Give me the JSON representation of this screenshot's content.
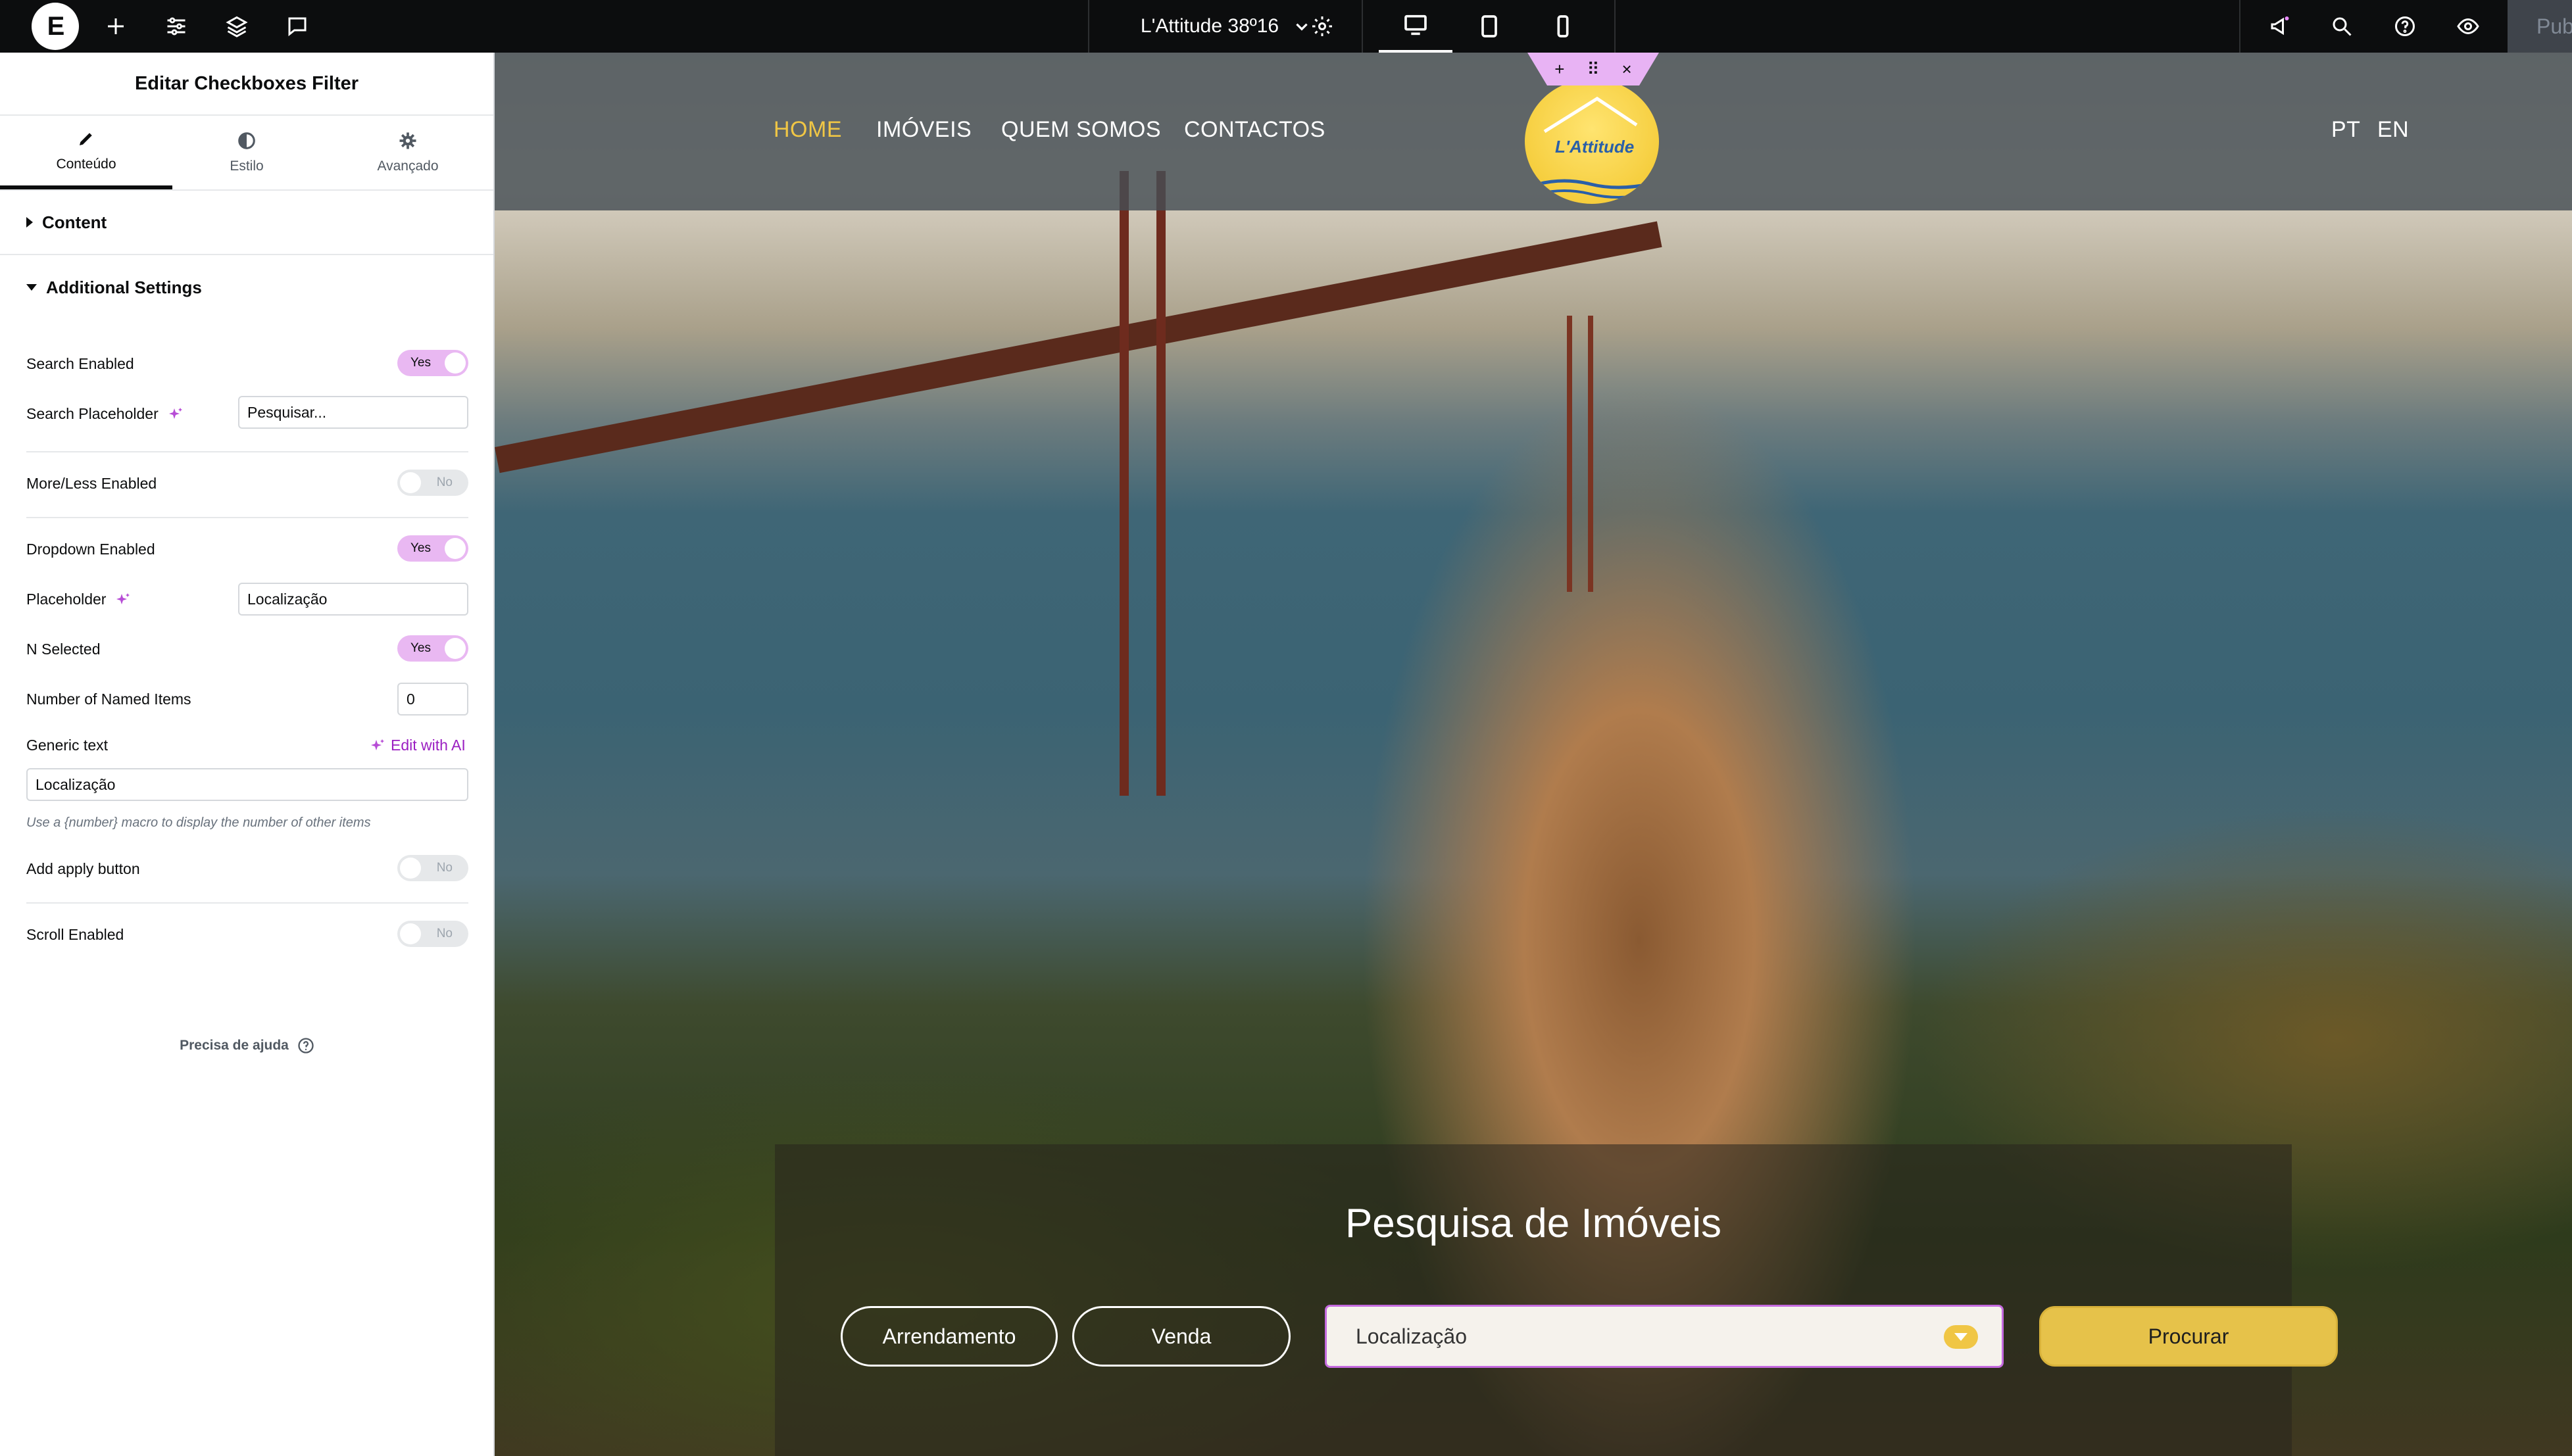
{
  "topbar": {
    "logo_letter": "E",
    "site_title": "L'Attitude 38º16",
    "publish_label": "Pub",
    "icons": [
      "elementor-logo-icon",
      "plus-icon",
      "sliders-icon",
      "layers-icon",
      "comment-icon",
      "settings-icon",
      "desktop-icon",
      "tablet-icon",
      "mobile-icon",
      "megaphone-icon",
      "search-icon",
      "help-icon",
      "eye-icon"
    ]
  },
  "panel": {
    "title": "Editar Checkboxes Filter",
    "tabs": [
      {
        "label": "Conteúdo"
      },
      {
        "label": "Estilo"
      },
      {
        "label": "Avançado"
      }
    ],
    "section_content": "Content",
    "section_additional": "Additional Settings",
    "controls": {
      "search_enabled": {
        "label": "Search Enabled",
        "value": "Yes"
      },
      "search_placeholder": {
        "label": "Search Placeholder",
        "value": "Pesquisar..."
      },
      "more_less": {
        "label": "More/Less Enabled",
        "value": "No"
      },
      "dropdown_enabled": {
        "label": "Dropdown Enabled",
        "value": "Yes"
      },
      "placeholder": {
        "label": "Placeholder",
        "value": "Localização"
      },
      "n_selected": {
        "label": "N Selected",
        "value": "Yes"
      },
      "named_items": {
        "label": "Number of Named Items",
        "value": "0"
      },
      "generic_text": {
        "label": "Generic text",
        "value": "Localização",
        "ai_label": "Edit with AI"
      },
      "hint": "Use a {number} macro to display the number of other items",
      "apply_button": {
        "label": "Add apply button",
        "value": "No"
      },
      "scroll_enabled": {
        "label": "Scroll Enabled",
        "value": "No"
      }
    },
    "help": "Precisa de ajuda"
  },
  "site": {
    "nav": [
      "HOME",
      "IMÓVEIS",
      "QUEM SOMOS",
      "CONTACTOS"
    ],
    "lang": [
      "PT",
      "EN"
    ],
    "logo_text": "L'Attitude",
    "search_title": "Pesquisa de Imóveis",
    "buttons": {
      "rent": "Arrendamento",
      "sale": "Venda",
      "search": "Procurar"
    },
    "location_select": "Localização",
    "colors": {
      "accent": "#f0c645",
      "editor_accent": "#e9b8f2",
      "topbar": "#0c0d0e"
    }
  }
}
